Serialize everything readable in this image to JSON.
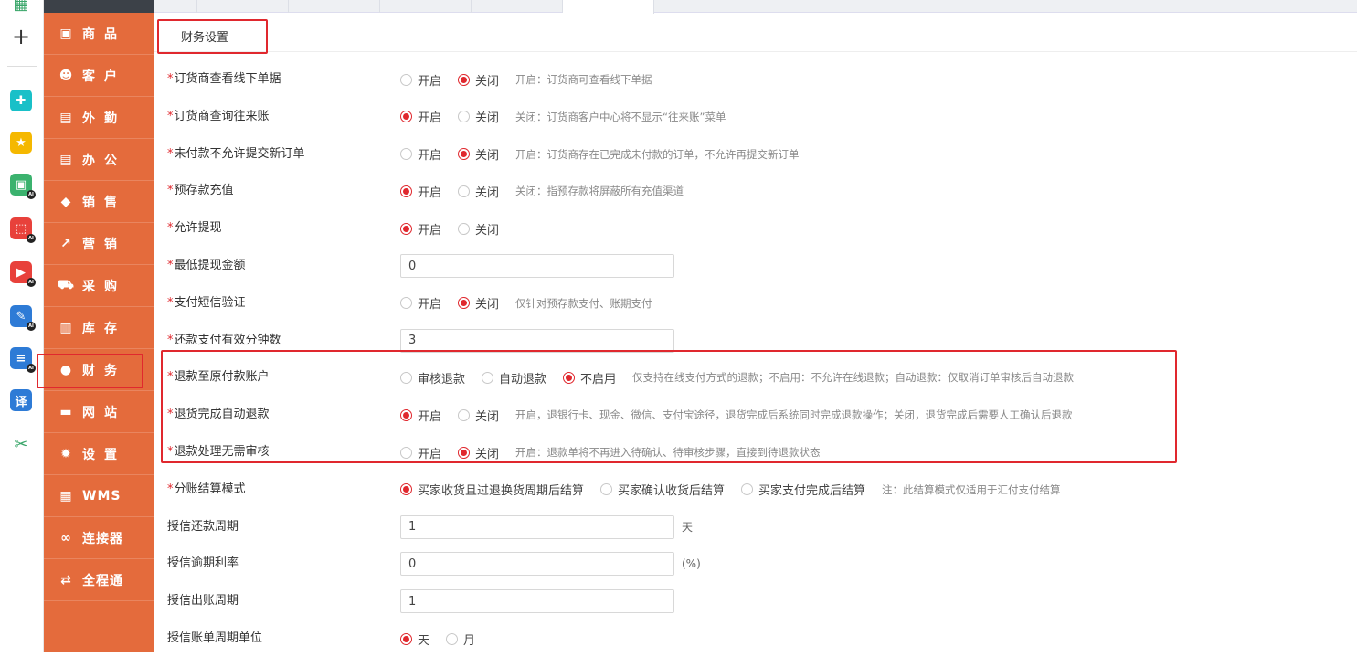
{
  "dock": {
    "items": [
      {
        "icon": "grid-icon",
        "color": "#3aa66a"
      },
      {
        "icon": "plus-icon",
        "color": "#333333"
      },
      {
        "icon": "plugin-icon",
        "color": "#19c0c8"
      },
      {
        "icon": "star-icon",
        "color": "#f5b800"
      },
      {
        "icon": "ai-image-icon",
        "color": "#3bb26e",
        "badge": "AI"
      },
      {
        "icon": "ai-pdf-icon",
        "color": "#e8413b",
        "badge": "AI"
      },
      {
        "icon": "ai-video-icon",
        "color": "#e8413b",
        "badge": "AI"
      },
      {
        "icon": "ai-edit-icon",
        "color": "#2e7bd6",
        "badge": "AI"
      },
      {
        "icon": "ai-doc-icon",
        "color": "#2e7bd6",
        "badge": "AI"
      },
      {
        "icon": "translate-icon",
        "color": "#2e7bd6",
        "glyph": "译"
      },
      {
        "icon": "scissors-icon",
        "color": "#3aa66a"
      }
    ]
  },
  "sidebar": {
    "items": [
      {
        "label": "商品",
        "icon": "bag-icon"
      },
      {
        "label": "客户",
        "icon": "customer-icon"
      },
      {
        "label": "外勤",
        "icon": "field-icon"
      },
      {
        "label": "办公",
        "icon": "office-icon"
      },
      {
        "label": "销售",
        "icon": "tag-icon"
      },
      {
        "label": "营销",
        "icon": "chart-icon"
      },
      {
        "label": "采购",
        "icon": "cart-icon"
      },
      {
        "label": "库存",
        "icon": "warehouse-icon"
      },
      {
        "label": "财务",
        "icon": "money-bag-icon",
        "active": true
      },
      {
        "label": "网站",
        "icon": "monitor-icon"
      },
      {
        "label": "设置",
        "icon": "gear-icon"
      },
      {
        "label": "WMS",
        "icon": "wms-icon"
      },
      {
        "label": "连接器",
        "icon": "link-icon"
      },
      {
        "label": "全程通",
        "icon": "transfer-icon"
      }
    ]
  },
  "subtab": {
    "label": "财务设置"
  },
  "rows": [
    {
      "label": "订货商查看线下单据",
      "required": true,
      "type": "radio",
      "options": [
        "开启",
        "关闭"
      ],
      "selected": 1,
      "hint": "开启：订货商可查看线下单据"
    },
    {
      "label": "订货商查询往来账",
      "required": true,
      "type": "radio",
      "options": [
        "开启",
        "关闭"
      ],
      "selected": 0,
      "hint": "关闭：订货商客户中心将不显示“往来账”菜单"
    },
    {
      "label": "未付款不允许提交新订单",
      "required": true,
      "type": "radio",
      "options": [
        "开启",
        "关闭"
      ],
      "selected": 1,
      "hint": "开启：订货商存在已完成未付款的订单，不允许再提交新订单"
    },
    {
      "label": "预存款充值",
      "required": true,
      "type": "radio",
      "options": [
        "开启",
        "关闭"
      ],
      "selected": 0,
      "hint": "关闭：指预存款将屏蔽所有充值渠道"
    },
    {
      "label": "允许提现",
      "required": true,
      "type": "radio",
      "options": [
        "开启",
        "关闭"
      ],
      "selected": 0,
      "hint": ""
    },
    {
      "label": "最低提现金额",
      "required": true,
      "type": "input",
      "value": "0"
    },
    {
      "label": "支付短信验证",
      "required": true,
      "type": "radio",
      "options": [
        "开启",
        "关闭"
      ],
      "selected": 1,
      "hint": "仅针对预存款支付、账期支付"
    },
    {
      "label": "还款支付有效分钟数",
      "required": true,
      "type": "input",
      "value": "3"
    },
    {
      "label": "退款至原付款账户",
      "required": true,
      "type": "radio",
      "options": [
        "审核退款",
        "自动退款",
        "不启用"
      ],
      "selected": 2,
      "hint": "仅支持在线支付方式的退款；不启用：不允许在线退款；自动退款：仅取消订单审核后自动退款"
    },
    {
      "label": "退货完成自动退款",
      "required": true,
      "type": "radio",
      "options": [
        "开启",
        "关闭"
      ],
      "selected": 0,
      "hint": "开启，退银行卡、现金、微信、支付宝途径，退货完成后系统同时完成退款操作；关闭，退货完成后需要人工确认后退款"
    },
    {
      "label": "退款处理无需审核",
      "required": true,
      "type": "radio",
      "options": [
        "开启",
        "关闭"
      ],
      "selected": 1,
      "hint": "开启：退款单将不再进入待确认、待审核步骤，直接到待退款状态"
    },
    {
      "label": "分账结算模式",
      "required": true,
      "type": "radio",
      "options": [
        "买家收货且过退换货周期后结算",
        "买家确认收货后结算",
        "买家支付完成后结算"
      ],
      "selected": 0,
      "hint": "注：此结算模式仅适用于汇付支付结算"
    },
    {
      "label": "授信还款周期",
      "required": false,
      "type": "input",
      "value": "1",
      "unit": "天"
    },
    {
      "label": "授信逾期利率",
      "required": false,
      "type": "input",
      "value": "0",
      "unit": "(%)"
    },
    {
      "label": "授信出账周期",
      "required": false,
      "type": "input",
      "value": "1"
    },
    {
      "label": "授信账单周期单位",
      "required": false,
      "type": "radio",
      "options": [
        "天",
        "月"
      ],
      "selected": 0,
      "hint": ""
    }
  ],
  "colors": {
    "accent": "#e46b3c",
    "highlight": "#e0282e",
    "hint": "#888888"
  }
}
